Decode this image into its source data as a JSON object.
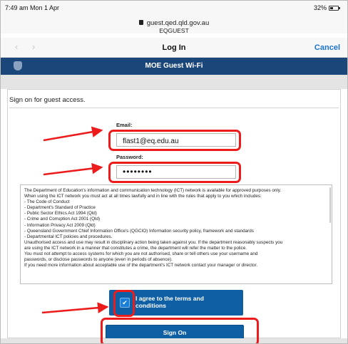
{
  "status_bar": {
    "time": "7:49 am  Mon 1 Apr",
    "battery_text": "32%"
  },
  "browser": {
    "url": "guest.qed.qld.gov.au",
    "network": "EQGUEST"
  },
  "nav": {
    "back_icon": "chevron-left-icon",
    "forward_icon": "chevron-right-icon",
    "title": "Log In",
    "cancel_label": "Cancel"
  },
  "brand": {
    "title": "MOE Guest Wi-Fi",
    "color": "#1b467a"
  },
  "form": {
    "intro": "Sign on for guest access.",
    "email_label": "Email:",
    "email_value": "flast1@eq.edu.au",
    "password_label": "Password:",
    "password_value": "••••••••"
  },
  "terms": {
    "lines": [
      "The Department of Education's information and communication technology (ICT) network is available for approved purposes only.",
      "When using the ICT network you must act at all times lawfully and in line with the rules that apply to you which includes:",
      "- The Code of Conduct",
      "- Department's Standard of Practice",
      "- Public Sector Ethics Act 1994 (Qld)",
      "- Crime and Corruption Act 2001 (Qld)",
      "- Information Privacy Act 2009 (Qld)",
      "- Queensland Government Chief Information Office's (QGCIO) Information security policy, framework and standards",
      "- Departmental ICT policies and procedures.",
      "Unauthorised access and use may result in disciplinary action being taken against you. If the department reasonably suspects you",
      "are using the ICT network in a manner that constitutes a crime, the department will refer the matter to the police.",
      "You must not attempt to access systems for which you are not authorised, share or tell others use your username and",
      "passwords, or disclose passwords to anyone (even in periods of absence).",
      "If you need more information about acceptable use of the department's ICT network contact your manager or director."
    ]
  },
  "agree": {
    "checked": true,
    "label": "I agree to the terms and conditions"
  },
  "sign_on": {
    "label": "Sign On"
  },
  "annotation_color": "#ec1c1c"
}
